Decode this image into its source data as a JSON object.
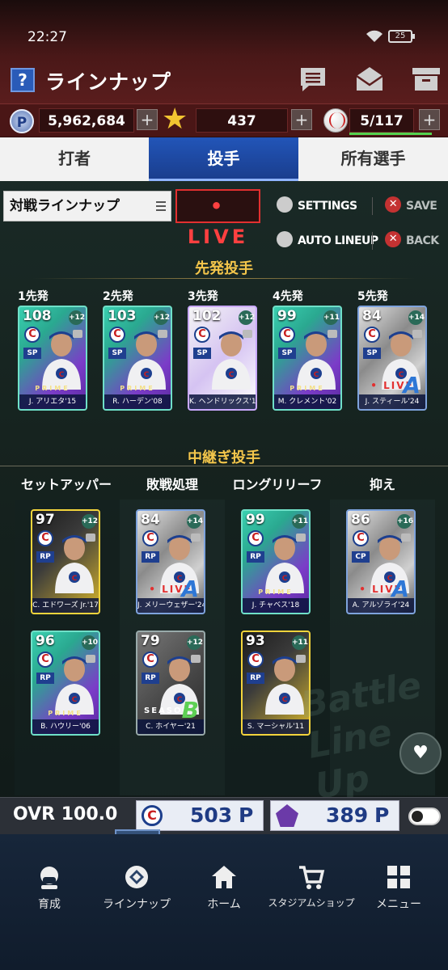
{
  "status": {
    "time": "22:27",
    "battery": "25"
  },
  "header": {
    "help_label": "?",
    "title": "ラインナップ"
  },
  "currency": {
    "points": "5,962,684",
    "stars": "437",
    "balls": "5/117",
    "point_symbol": "P",
    "plus": "+"
  },
  "tabs": [
    {
      "label": "打者",
      "active": false
    },
    {
      "label": "投手",
      "active": true
    },
    {
      "label": "所有選手",
      "active": false
    }
  ],
  "controls": {
    "lineup_select": "対戦ラインナップ",
    "live": "• LIVE",
    "settings": "SETTINGS",
    "save": "SAVE",
    "auto_lineup": "AUTO LINEUP",
    "back": "BACK"
  },
  "starters": {
    "title": "先発投手",
    "slots": [
      {
        "slot": "1先発",
        "ovr": "108",
        "pot": "+12",
        "pos": "SP",
        "name": "J. アリエタ'15",
        "style": "prime"
      },
      {
        "slot": "2先発",
        "ovr": "103",
        "pot": "+12",
        "pos": "SP",
        "name": "R. ハーデン'08",
        "style": "prime"
      },
      {
        "slot": "3先発",
        "ovr": "102",
        "pot": "+12",
        "pos": "SP",
        "name": "K. ヘンドリックス'18",
        "style": "white"
      },
      {
        "slot": "4先発",
        "ovr": "99",
        "pot": "+11",
        "pos": "SP",
        "name": "M. クレメント'02",
        "style": "prime"
      },
      {
        "slot": "5先発",
        "ovr": "84",
        "pot": "+14",
        "pos": "SP",
        "name": "J. スティール'24",
        "style": "live"
      }
    ]
  },
  "relievers": {
    "title": "中継ぎ投手",
    "roles": [
      "セットアッパー",
      "敗戦処理",
      "ロングリリーフ",
      "抑え"
    ],
    "cards": [
      {
        "ovr": "97",
        "pot": "+12",
        "pos": "RP",
        "name": "C. エドワーズ Jr.'17",
        "style": "gold"
      },
      {
        "ovr": "84",
        "pot": "+14",
        "pos": "RP",
        "name": "J. メリーウェザー'24",
        "style": "live"
      },
      {
        "ovr": "99",
        "pot": "+11",
        "pos": "RP",
        "name": "J. チャベス'18",
        "style": "prime"
      },
      {
        "ovr": "86",
        "pot": "+16",
        "pos": "CP",
        "name": "A. アルゾライ'24",
        "style": "live"
      },
      {
        "ovr": "96",
        "pot": "+10",
        "pos": "RP",
        "name": "B. ハウリー'06",
        "style": "prime"
      },
      {
        "ovr": "79",
        "pot": "+12",
        "pos": "RP",
        "name": "C. ホイヤー'21",
        "style": "season"
      },
      {
        "ovr": "93",
        "pot": "+11",
        "pos": "RP",
        "name": "S. マーシャル'11",
        "style": "gold"
      }
    ],
    "card_tags": {
      "live": "• LIVE",
      "season": "SEASON",
      "prime": "PRIME",
      "season_grade": "B",
      "live_grade": "A"
    }
  },
  "watermark": "Battle Line Up",
  "ovr_bar": {
    "label": "OVR",
    "value": "100.0",
    "team_points": "503",
    "rival_points": "389",
    "p_symbol": "P",
    "team_logo": "C"
  },
  "nav": [
    {
      "label": "育成",
      "icon": "player-icon"
    },
    {
      "label": "ラインナップ",
      "icon": "diamond-icon",
      "active": true
    },
    {
      "label": "ホーム",
      "icon": "home-icon"
    },
    {
      "label": "スタジアムショップ",
      "icon": "cart-icon"
    },
    {
      "label": "メニュー",
      "icon": "grid-icon"
    }
  ],
  "colors": {
    "accent_tab": "#2255b8",
    "live_red": "#e23030",
    "section_gold": "#f4c64b"
  }
}
